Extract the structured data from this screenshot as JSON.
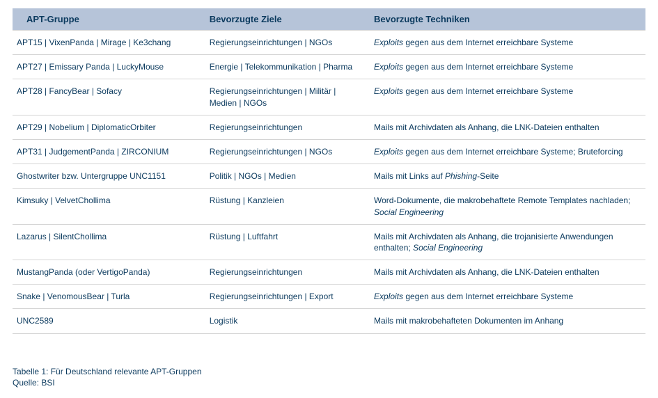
{
  "chart_data": {
    "type": "table",
    "title": "Tabelle 1: Für Deutschland relevante APT-Gruppen",
    "headers": [
      "APT-Gruppe",
      "Bevorzugte Ziele",
      "Bevorzugte Techniken"
    ],
    "rows": [
      {
        "group": "APT15 | VixenPanda | Mirage | Ke3chang",
        "targets": "Regierungseinrichtungen | NGOs",
        "technique_html": "<span class='em'>Exploits</span> gegen aus dem Internet erreichbare Systeme"
      },
      {
        "group": "APT27 | Emissary Panda | LuckyMouse",
        "targets": "Energie | Telekommunikation | Pharma",
        "technique_html": "<span class='em'>Exploits</span> gegen aus dem Internet erreichbare Systeme"
      },
      {
        "group": "APT28 | FancyBear | Sofacy",
        "targets": "Regierungseinrichtungen | Militär | Medien | NGOs",
        "technique_html": "<span class='em'>Exploits</span> gegen aus dem Internet erreichbare Systeme"
      },
      {
        "group": "APT29 | Nobelium | DiplomaticOrbiter",
        "targets": "Regierungseinrichtungen",
        "technique_html": "Mails mit Archivdaten als Anhang, die LNK-Dateien enthalten"
      },
      {
        "group": "APT31 | JudgementPanda | ZIRCONIUM",
        "targets": "Regierungseinrichtungen | NGOs",
        "technique_html": "<span class='em'>Exploits</span> gegen aus dem Internet erreichbare Systeme; Bruteforcing"
      },
      {
        "group": "Ghostwriter bzw. Untergruppe UNC1151",
        "targets": "Politik | NGOs |  Medien",
        "technique_html": "Mails mit Links auf <span class='em'>Phishing</span>-Seite"
      },
      {
        "group": "Kimsuky | VelvetChollima",
        "targets": "Rüstung | Kanzleien",
        "technique_html": "Word-Dokumente, die makrobehaftete Remote Templates nachladen; <span class='em'>Social Engineering</span>"
      },
      {
        "group": "Lazarus | SilentChollima",
        "targets": "Rüstung | Luftfahrt",
        "technique_html": "Mails mit Archivdaten als Anhang, die trojanisierte Anwendungen enthalten; <span class='em'>Social Engineering</span>"
      },
      {
        "group": "MustangPanda (oder VertigoPanda)",
        "targets": "Regierungseinrichtungen",
        "technique_html": "Mails mit Archivdaten als Anhang, die LNK-Dateien enthalten"
      },
      {
        "group": "Snake | VenomousBear | Turla",
        "targets": "Regierungseinrichtungen | Export",
        "technique_html": "<span class='em'>Exploits</span> gegen aus dem Internet erreichbare Systeme"
      },
      {
        "group": "UNC2589",
        "targets": "Logistik",
        "technique_html": "Mails mit makrobehafteten Dokumenten im Anhang"
      }
    ]
  },
  "caption_line1": "Tabelle 1: Für Deutschland relevante APT-Gruppen",
  "caption_line2": "Quelle: BSI"
}
